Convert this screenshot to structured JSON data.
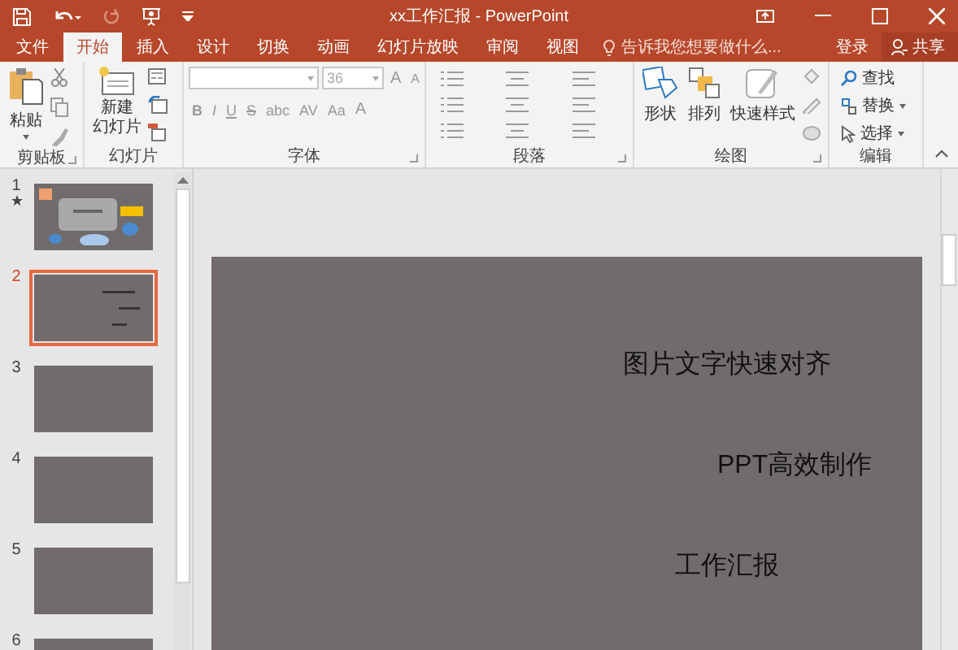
{
  "window": {
    "title": "xx工作汇报 - PowerPoint"
  },
  "quick_access": [
    {
      "kind": "save",
      "disabled": false
    },
    {
      "kind": "undo",
      "disabled": false
    },
    {
      "kind": "redo",
      "disabled": true
    },
    {
      "kind": "present",
      "disabled": false
    },
    {
      "kind": "customize",
      "disabled": false
    }
  ],
  "tabs": [
    {
      "label": "文件",
      "selected": false
    },
    {
      "label": "开始",
      "selected": true
    },
    {
      "label": "插入",
      "selected": false
    },
    {
      "label": "设计",
      "selected": false
    },
    {
      "label": "切换",
      "selected": false
    },
    {
      "label": "动画",
      "selected": false
    },
    {
      "label": "幻灯片放映",
      "selected": false
    },
    {
      "label": "审阅",
      "selected": false
    },
    {
      "label": "视图",
      "selected": false
    }
  ],
  "tell_me": {
    "placeholder": "告诉我您想要做什么..."
  },
  "sign_in": "登录",
  "share": "共享",
  "ribbon": {
    "clipboard": {
      "label": "剪贴板",
      "paste": "粘贴"
    },
    "slides": {
      "label": "幻灯片",
      "new_slide": [
        "新建",
        "幻灯片"
      ]
    },
    "font": {
      "label": "字体",
      "font_size": "36",
      "size_buttons": [
        "A",
        "A"
      ],
      "styles": [
        "B",
        "I",
        "U",
        "S",
        "abc",
        "AV",
        "Aa"
      ],
      "color_button": "A"
    },
    "paragraph": {
      "label": "段落"
    },
    "drawing": {
      "label": "绘图",
      "buttons": [
        "形状",
        "排列",
        "快速样式"
      ]
    },
    "editing": {
      "label": "编辑",
      "buttons": [
        {
          "kind": "find",
          "label": "查找"
        },
        {
          "kind": "replace",
          "label": "替换"
        },
        {
          "kind": "select",
          "label": "选择"
        }
      ]
    }
  },
  "slides": [
    {
      "number": "1",
      "starred": true,
      "selected": false,
      "kind": "title"
    },
    {
      "number": "2",
      "starred": false,
      "selected": true,
      "kind": "text"
    },
    {
      "number": "3",
      "starred": false,
      "selected": false,
      "kind": "blank"
    },
    {
      "number": "4",
      "starred": false,
      "selected": false,
      "kind": "blank"
    },
    {
      "number": "5",
      "starred": false,
      "selected": false,
      "kind": "blank"
    },
    {
      "number": "6",
      "starred": false,
      "selected": false,
      "kind": "blank"
    }
  ],
  "current_slide": {
    "texts": [
      "图片文字快速对齐",
      "PPT高效制作",
      "工作汇报"
    ]
  }
}
